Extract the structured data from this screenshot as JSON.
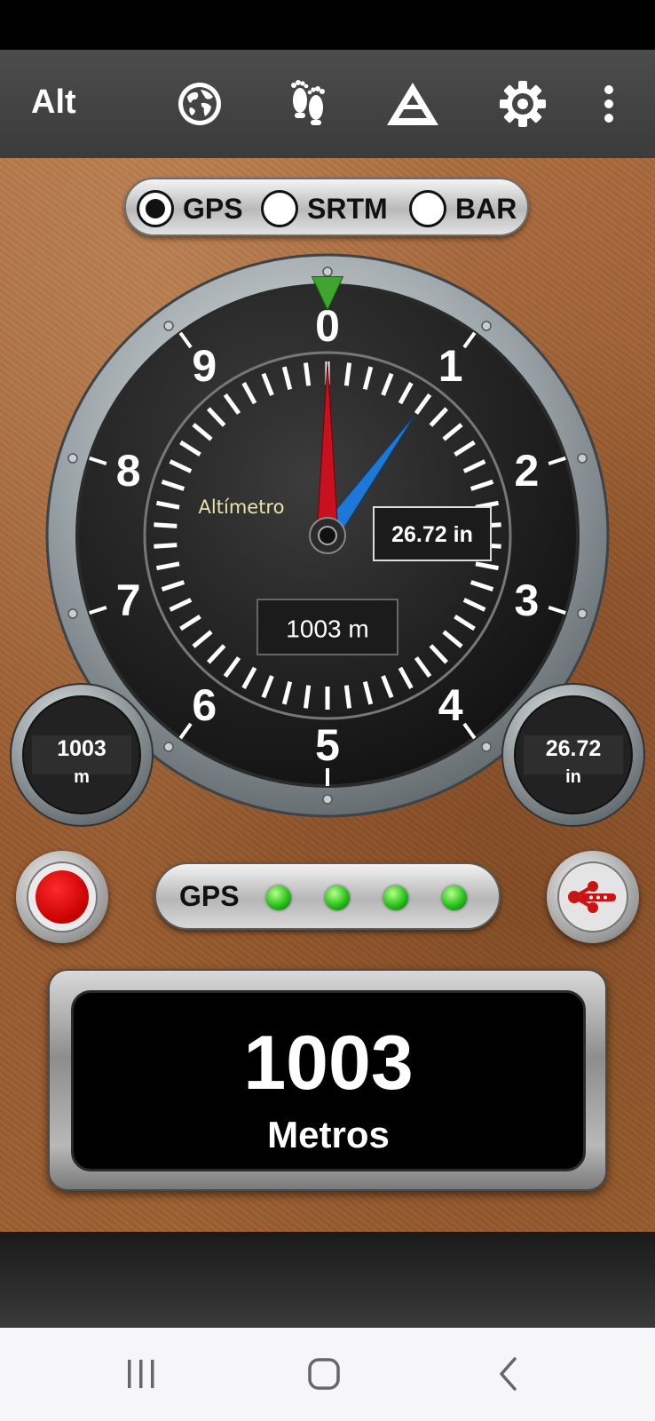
{
  "app_bar": {
    "title": "Alt",
    "icons": [
      "globe-icon",
      "footprints-icon",
      "mountain-icon",
      "gear-icon",
      "more-vert-icon"
    ]
  },
  "source_selector": {
    "options": [
      "GPS",
      "SRTM",
      "BAR"
    ],
    "selected": "GPS"
  },
  "gauge": {
    "dial_numbers": [
      "0",
      "1",
      "2",
      "3",
      "4",
      "5",
      "6",
      "7",
      "8",
      "9"
    ],
    "label": "Altímetro",
    "pressure_readout": "26.72 in",
    "altitude_readout": "1003 m",
    "pointer_fraction": 0.0,
    "needle_fraction": 0.1
  },
  "mini_gauges": {
    "left": {
      "value": "1003",
      "unit": "m"
    },
    "right": {
      "value": "26.72",
      "unit": "in"
    }
  },
  "gps_status": {
    "label": "GPS",
    "leds_on": 4
  },
  "main_readout": {
    "value": "1003",
    "unit": "Metros"
  },
  "colors": {
    "leather": "#a86a3a",
    "needle_red": "#c8101e",
    "needle_blue": "#1e78d6",
    "marker_green": "#3fa52e",
    "led_green": "#26c21a",
    "record_red": "#c60000"
  }
}
